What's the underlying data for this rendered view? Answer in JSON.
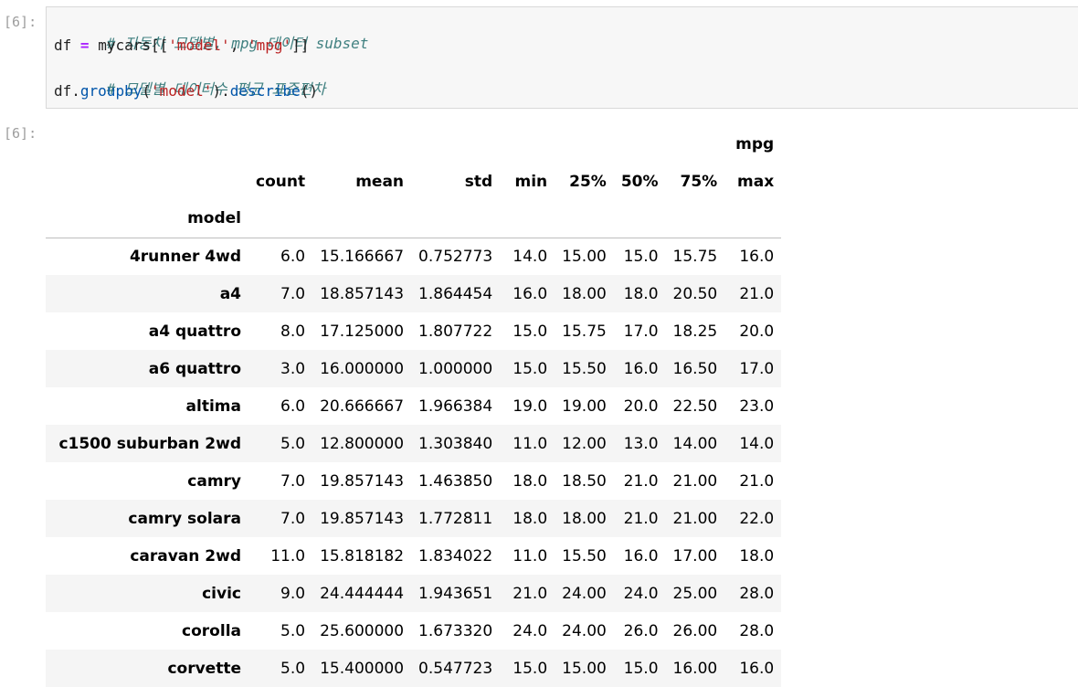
{
  "input_cell": {
    "prompt": "[6]:",
    "comment1": "# 자동차 모델별, mpg 데이터 subset",
    "line2": {
      "var": "df",
      "eq": "=",
      "obj": "mycars[[",
      "s1": "'model'",
      "comma": ", ",
      "s2": "'mpg'",
      "close": "]]"
    },
    "comment2": "# 모델별 데이터수 평균 표준편차",
    "line4": {
      "obj": "df",
      "dot1": ".",
      "fn1": "groupby",
      "open1": "(",
      "s": "'model'",
      "close1": ")",
      "dot2": ".",
      "fn2": "describe",
      "call2": "()"
    }
  },
  "output_cell": {
    "prompt": "[6]:",
    "group_header": "mpg",
    "index_name": "model",
    "columns": [
      "count",
      "mean",
      "std",
      "min",
      "25%",
      "50%",
      "75%",
      "max"
    ],
    "rows": [
      {
        "model": "4runner 4wd",
        "values": [
          "6.0",
          "15.166667",
          "0.752773",
          "14.0",
          "15.00",
          "15.0",
          "15.75",
          "16.0"
        ]
      },
      {
        "model": "a4",
        "values": [
          "7.0",
          "18.857143",
          "1.864454",
          "16.0",
          "18.00",
          "18.0",
          "20.50",
          "21.0"
        ]
      },
      {
        "model": "a4 quattro",
        "values": [
          "8.0",
          "17.125000",
          "1.807722",
          "15.0",
          "15.75",
          "17.0",
          "18.25",
          "20.0"
        ]
      },
      {
        "model": "a6 quattro",
        "values": [
          "3.0",
          "16.000000",
          "1.000000",
          "15.0",
          "15.50",
          "16.0",
          "16.50",
          "17.0"
        ]
      },
      {
        "model": "altima",
        "values": [
          "6.0",
          "20.666667",
          "1.966384",
          "19.0",
          "19.00",
          "20.0",
          "22.50",
          "23.0"
        ]
      },
      {
        "model": "c1500 suburban 2wd",
        "values": [
          "5.0",
          "12.800000",
          "1.303840",
          "11.0",
          "12.00",
          "13.0",
          "14.00",
          "14.0"
        ]
      },
      {
        "model": "camry",
        "values": [
          "7.0",
          "19.857143",
          "1.463850",
          "18.0",
          "18.50",
          "21.0",
          "21.00",
          "21.0"
        ]
      },
      {
        "model": "camry solara",
        "values": [
          "7.0",
          "19.857143",
          "1.772811",
          "18.0",
          "18.00",
          "21.0",
          "21.00",
          "22.0"
        ]
      },
      {
        "model": "caravan 2wd",
        "values": [
          "11.0",
          "15.818182",
          "1.834022",
          "11.0",
          "15.50",
          "16.0",
          "17.00",
          "18.0"
        ]
      },
      {
        "model": "civic",
        "values": [
          "9.0",
          "24.444444",
          "1.943651",
          "21.0",
          "24.00",
          "24.0",
          "25.00",
          "28.0"
        ]
      },
      {
        "model": "corolla",
        "values": [
          "5.0",
          "25.600000",
          "1.673320",
          "24.0",
          "24.00",
          "26.0",
          "26.00",
          "28.0"
        ]
      },
      {
        "model": "corvette",
        "values": [
          "5.0",
          "15.400000",
          "0.547723",
          "15.0",
          "15.00",
          "15.0",
          "16.00",
          "16.0"
        ]
      }
    ]
  }
}
